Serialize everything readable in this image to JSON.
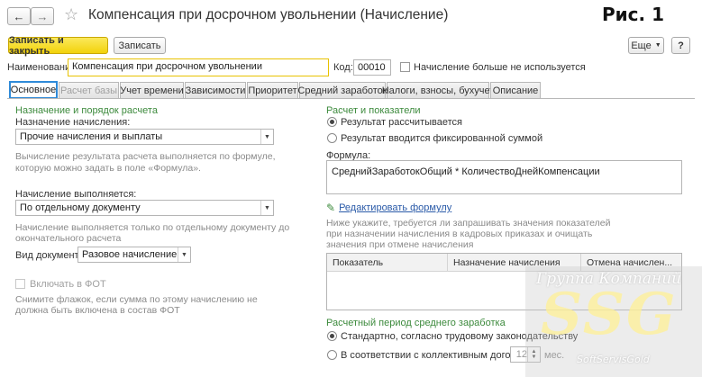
{
  "window": {
    "title": "Компенсация при досрочном увольнении (Начисление)",
    "figure_label": "Рис. 1"
  },
  "toolbar": {
    "save_close_label": "Записать и закрыть",
    "save_label": "Записать",
    "more_label": "Еще",
    "help_label": "?"
  },
  "header": {
    "name_label": "Наименование:",
    "name_value": "Компенсация при досрочном увольнении",
    "code_label": "Код:",
    "code_value": "00010",
    "unused_label": "Начисление больше не используется"
  },
  "tabs": [
    {
      "label": "Основное",
      "state": "active"
    },
    {
      "label": "Расчет базы",
      "state": "disabled"
    },
    {
      "label": "Учет времени",
      "state": "normal"
    },
    {
      "label": "Зависимости",
      "state": "normal"
    },
    {
      "label": "Приоритет",
      "state": "normal"
    },
    {
      "label": "Средний заработок",
      "state": "normal"
    },
    {
      "label": "Налоги, взносы, бухучет",
      "state": "normal"
    },
    {
      "label": "Описание",
      "state": "normal"
    }
  ],
  "left": {
    "section_title": "Назначение и порядок расчета",
    "purpose_label": "Назначение начисления:",
    "purpose_value": "Прочие начисления и выплаты",
    "purpose_hint_1": "Вычисление результата расчета выполняется по формуле,",
    "purpose_hint_2": "которую можно задать в поле «Формула».",
    "performed_label": "Начисление выполняется:",
    "performed_value": "По отдельному документу",
    "performed_hint_1": "Начисление выполняется только по отдельному документу до",
    "performed_hint_2": "окончательного расчета",
    "doc_type_label": "Вид документа:",
    "doc_type_value": "Разовое начисление",
    "fot_label": "Включать в ФОТ",
    "fot_hint_1": "Снимите флажок, если сумма по этому начислению не",
    "fot_hint_2": "должна быть включена в состав ФОТ"
  },
  "right": {
    "section_title": "Расчет и показатели",
    "radio_calc": "Результат рассчитывается",
    "radio_fixed": "Результат вводится фиксированной суммой",
    "formula_label": "Формула:",
    "formula_value": "СреднийЗаработокОбщий * КоличествоДнейКомпенсации",
    "edit_formula_link": "Редактировать формулу",
    "indicators_hint_1": "Ниже укажите, требуется ли запрашивать значения показателей",
    "indicators_hint_2": "при назначении начисления в кадровых приказах и очищать",
    "indicators_hint_3": "значения при отмене начисления",
    "table_headers": [
      "Показатель",
      "Назначение начисления",
      "Отмена начислен..."
    ],
    "avg_section_title": "Расчетный период среднего заработка",
    "avg_radio_standard": "Стандартно, согласно трудовому законодательству",
    "avg_radio_contract": "В соответствии с коллективным договором",
    "months_value": "12",
    "months_unit": "мес."
  },
  "watermark": {
    "line1": "Группа Компаний",
    "logo": "SSG",
    "line2": "SoftServisGold"
  },
  "colors": {
    "accent_blue": "#2f8ad8",
    "primary_yellow": "#f2d20b",
    "section_green": "#3c8a3c",
    "link_blue": "#2a5aa8",
    "name_field_border": "#e8c200"
  }
}
